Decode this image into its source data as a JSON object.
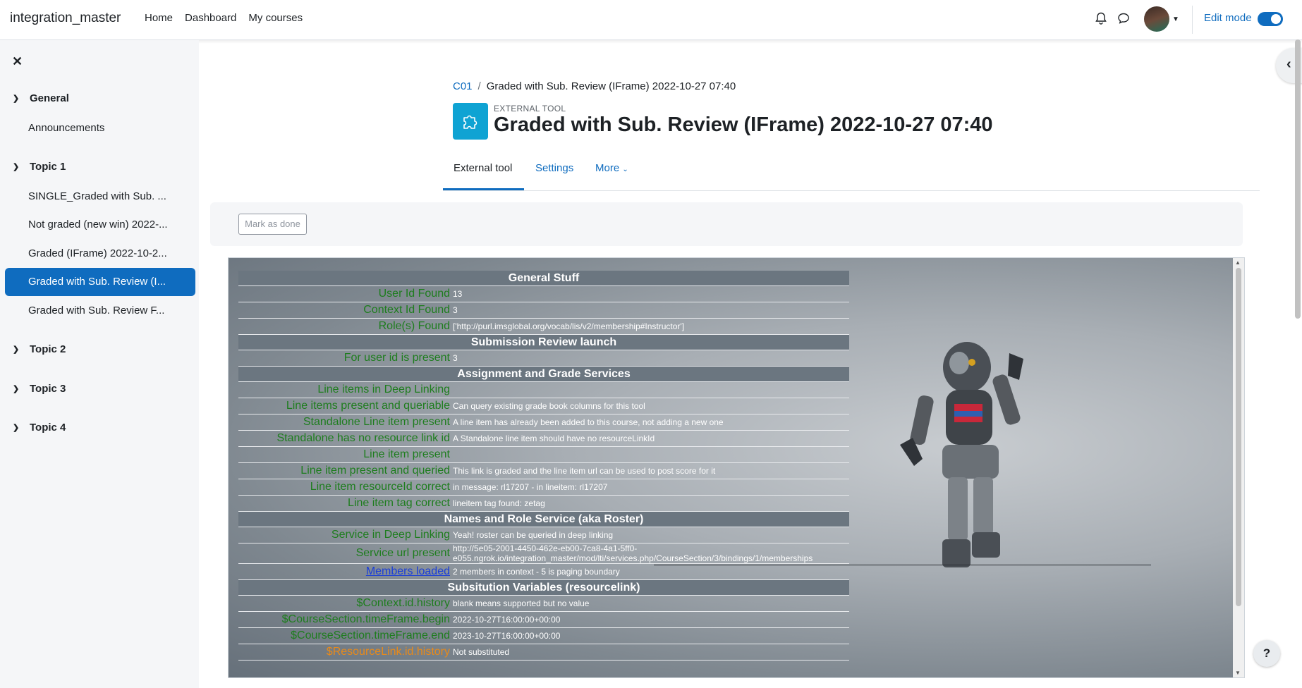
{
  "navbar": {
    "site_name": "integration_master",
    "links": [
      "Home",
      "Dashboard",
      "My courses"
    ],
    "edit_mode_label": "Edit mode"
  },
  "drawer": {
    "sections": [
      {
        "title": "General",
        "items": [
          "Announcements"
        ]
      },
      {
        "title": "Topic 1",
        "items": [
          "SINGLE_Graded with Sub. ...",
          "Not graded (new win) 2022-...",
          "Graded (IFrame) 2022-10-2...",
          "Graded with Sub. Review (I...",
          "Graded with Sub. Review F..."
        ]
      },
      {
        "title": "Topic 2",
        "items": []
      },
      {
        "title": "Topic 3",
        "items": []
      },
      {
        "title": "Topic 4",
        "items": []
      }
    ]
  },
  "breadcrumb": {
    "course": "C01",
    "current": "Graded with Sub. Review (IFrame) 2022-10-27 07:40"
  },
  "header": {
    "type_label": "EXTERNAL TOOL",
    "title": "Graded with Sub. Review (IFrame) 2022-10-27 07:40"
  },
  "tabs": [
    "External tool",
    "Settings",
    "More"
  ],
  "mark_done_label": "Mark as done",
  "help_label": "?",
  "lti_rows": [
    {
      "type": "head",
      "text": "General Stuff"
    },
    {
      "label": "User Id Found",
      "value": "13"
    },
    {
      "label": "Context Id Found",
      "value": "3"
    },
    {
      "label": "Role(s) Found",
      "value": "['http://purl.imsglobal.org/vocab/lis/v2/membership#Instructor']"
    },
    {
      "type": "head",
      "text": "Submission Review launch"
    },
    {
      "label": "For user id is present",
      "value": "3"
    },
    {
      "type": "head",
      "text": "Assignment and Grade Services"
    },
    {
      "label": "Line items in Deep Linking",
      "value": ""
    },
    {
      "label": "Line items present and queriable",
      "value": "Can query existing grade book columns for this tool"
    },
    {
      "label": "Standalone Line item present",
      "value": "A line item has already been added to this course, not adding a new one"
    },
    {
      "label": "Standalone has no resource link id",
      "value": "A Standalone line item should have no resourceLinkId"
    },
    {
      "label": "Line item present",
      "value": ""
    },
    {
      "label": "Line item present and queried",
      "value": "This link is graded and the line item url can be used to post score for it"
    },
    {
      "label": "Line item resourceId correct",
      "value": "in message: rl17207 - in lineitem: rl17207"
    },
    {
      "label": "Line item tag correct",
      "value": "lineitem tag found: zetag"
    },
    {
      "type": "head",
      "text": "Names and Role Service (aka Roster)"
    },
    {
      "label": "Service in Deep Linking",
      "value": "Yeah! roster can be queried in deep linking"
    },
    {
      "label": "Service url present",
      "value": "http://5e05-2001-4450-462e-eb00-7ca8-4a1-5ff0-e055.ngrok.io/integration_master/mod/lti/services.php/CourseSection/3/bindings/1/memberships",
      "tall": true
    },
    {
      "label": "Members loaded",
      "value": "2 members in context - 5 is paging boundary",
      "link": true
    },
    {
      "type": "head",
      "text": "Subsitution Variables (resourcelink)"
    },
    {
      "label": "$Context.id.history",
      "value": "blank means supported but no value"
    },
    {
      "label": "$CourseSection.timeFrame.begin",
      "value": "2022-10-27T16:00:00+00:00"
    },
    {
      "label": "$CourseSection.timeFrame.end",
      "value": "2023-10-27T16:00:00+00:00"
    },
    {
      "label": "$ResourceLink.id.history",
      "value": "Not substituted",
      "orange": true
    }
  ]
}
